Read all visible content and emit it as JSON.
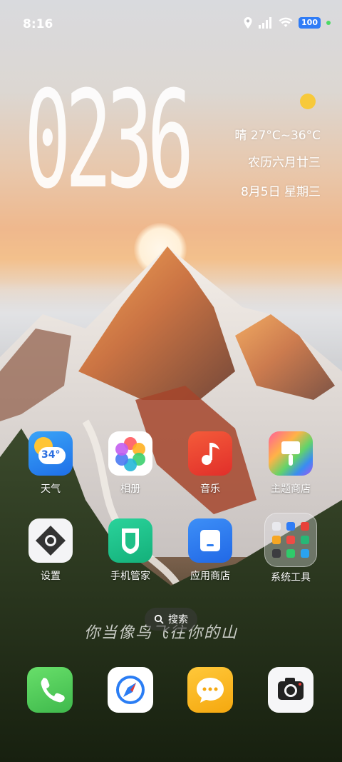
{
  "status_bar": {
    "time": "8:16",
    "battery": "100"
  },
  "clock_widget": {
    "time": "0236"
  },
  "weather_widget": {
    "condition_temp": "晴  27°C~36°C",
    "lunar_date": "农历六月廿三",
    "date": "8月5日 星期三"
  },
  "home_apps": [
    {
      "label": "天气",
      "icon": "weather-icon"
    },
    {
      "label": "相册",
      "icon": "gallery-icon"
    },
    {
      "label": "音乐",
      "icon": "music-icon"
    },
    {
      "label": "主题商店",
      "icon": "theme-store-icon"
    },
    {
      "label": "设置",
      "icon": "settings-icon"
    },
    {
      "label": "手机管家",
      "icon": "phone-manager-icon"
    },
    {
      "label": "应用商店",
      "icon": "app-store-icon"
    },
    {
      "label": "系统工具",
      "icon": "system-tools-folder-icon"
    }
  ],
  "weather_icon_text": "34°",
  "search": {
    "label": "搜索"
  },
  "signature_text": "你当像鸟飞往你的山",
  "dock": [
    {
      "icon": "phone-icon"
    },
    {
      "icon": "browser-icon"
    },
    {
      "icon": "messages-icon"
    },
    {
      "icon": "camera-icon"
    }
  ],
  "colors": {
    "accent": "#2f7cf6",
    "music": "#ea3b2e",
    "phone": "#4fc75a",
    "manager": "#1ec08e",
    "messages": "#f6b71e"
  }
}
